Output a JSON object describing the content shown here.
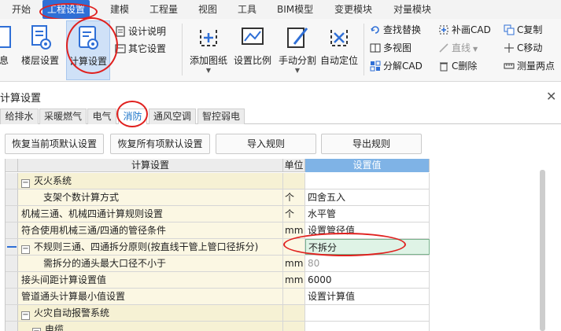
{
  "menu": {
    "items": [
      "开始",
      "工程设置",
      "建模",
      "工程量",
      "视图",
      "工具",
      "BIM模型",
      "变更模块",
      "对量模块"
    ],
    "active": "工程设置"
  },
  "ribbon": {
    "cut_label": "息",
    "floor_settings": "楼层设置",
    "calc_settings": "计算设置",
    "design_notes": "设计说明",
    "other_settings": "其它设置",
    "add_drawing": "添加图纸",
    "set_scale": "设置比例",
    "manual_split": "手动分割",
    "auto_locate": "自动定位",
    "find_replace": "查找替换",
    "multi_view": "多视图",
    "explode_cad": "分解CAD",
    "fill_cad": "补画CAD",
    "line_tool": "直线",
    "delete_cad": "C删除",
    "copy_cad": "C复制",
    "move_cad": "C移动",
    "measure": "测量两点"
  },
  "dialog": {
    "title": "计算设置",
    "close": "✕",
    "tabs": [
      "给排水",
      "采暖燃气",
      "电气",
      "消防",
      "通风空调",
      "智控弱电"
    ],
    "active_tab": "消防",
    "buttons": {
      "restore_current": "恢复当前项默认设置",
      "restore_all": "恢复所有项默认设置",
      "import_rules": "导入规则",
      "export_rules": "导出规则"
    }
  },
  "grid": {
    "headers": {
      "name": "计算设置",
      "unit": "单位",
      "value": "设置值"
    },
    "rows": [
      {
        "name": "灭火系统",
        "unit": "",
        "value": "",
        "group": true,
        "expander": "−"
      },
      {
        "name": "支架个数计算方式",
        "unit": "个",
        "value": "四舍五入",
        "indent": 2
      },
      {
        "name": "机械三通、机械四通计算规则设置",
        "unit": "个",
        "value": "水平管"
      },
      {
        "name": "符合使用机械三通/四通的管径条件",
        "unit": "mm",
        "value": "设置管径值"
      },
      {
        "name": "不规则三通、四通拆分原则(按直线干管上管口径拆分)",
        "unit": "",
        "value": "不拆分",
        "expander": "−",
        "selected": true,
        "editing": true
      },
      {
        "name": "需拆分的通头最大口径不小于",
        "unit": "mm",
        "value": "80",
        "indent": 2,
        "grey": true
      },
      {
        "name": "接头间距计算设置值",
        "unit": "mm",
        "value": "6000"
      },
      {
        "name": "管道通头计算最小值设置",
        "unit": "",
        "value": "设置计算值"
      },
      {
        "name": "火灾自动报警系统",
        "unit": "",
        "value": "",
        "group": true,
        "expander": "−"
      },
      {
        "name": "电缆",
        "unit": "",
        "value": "",
        "group": true,
        "expander": "−",
        "indent": 1
      }
    ]
  },
  "colors": {
    "accent": "#2f6fd6",
    "annotation": "#e0201e",
    "row_bg": "#fbf7e3",
    "header_value_bg": "#7fb3e6",
    "editing_bg": "#dff3e6"
  }
}
